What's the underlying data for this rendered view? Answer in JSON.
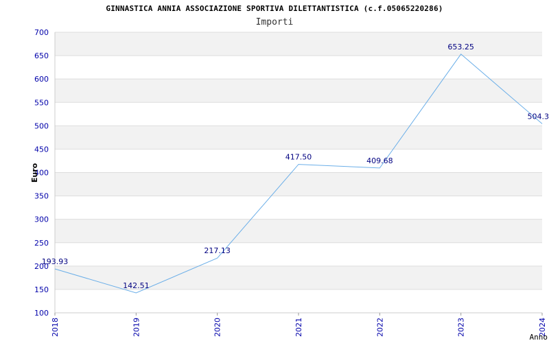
{
  "chart_data": {
    "type": "line",
    "title": "GINNASTICA ANNIA ASSOCIAZIONE SPORTIVA DILETTANTISTICA (c.f.05065220286)",
    "subtitle": "Importi",
    "xlabel": "Anno",
    "ylabel": "Euro",
    "ylim": [
      100,
      700
    ],
    "yticks": [
      "100",
      "150",
      "200",
      "250",
      "300",
      "350",
      "400",
      "450",
      "500",
      "550",
      "600",
      "650",
      "700"
    ],
    "categories": [
      "2018",
      "2019",
      "2020",
      "2021",
      "2022",
      "2023",
      "2024"
    ],
    "values": [
      193.93,
      142.51,
      217.13,
      417.5,
      409.68,
      653.25,
      504.3
    ],
    "value_labels": [
      "193.93",
      "142.51",
      "217.13",
      "417.50",
      "409.68",
      "653.25",
      "504.3"
    ],
    "grid": true,
    "colors": {
      "line": "#6aaee8",
      "band": "#f2f2f2",
      "grid": "#dddddd",
      "tick_text": "#0000aa",
      "value_text": "#000080"
    }
  }
}
